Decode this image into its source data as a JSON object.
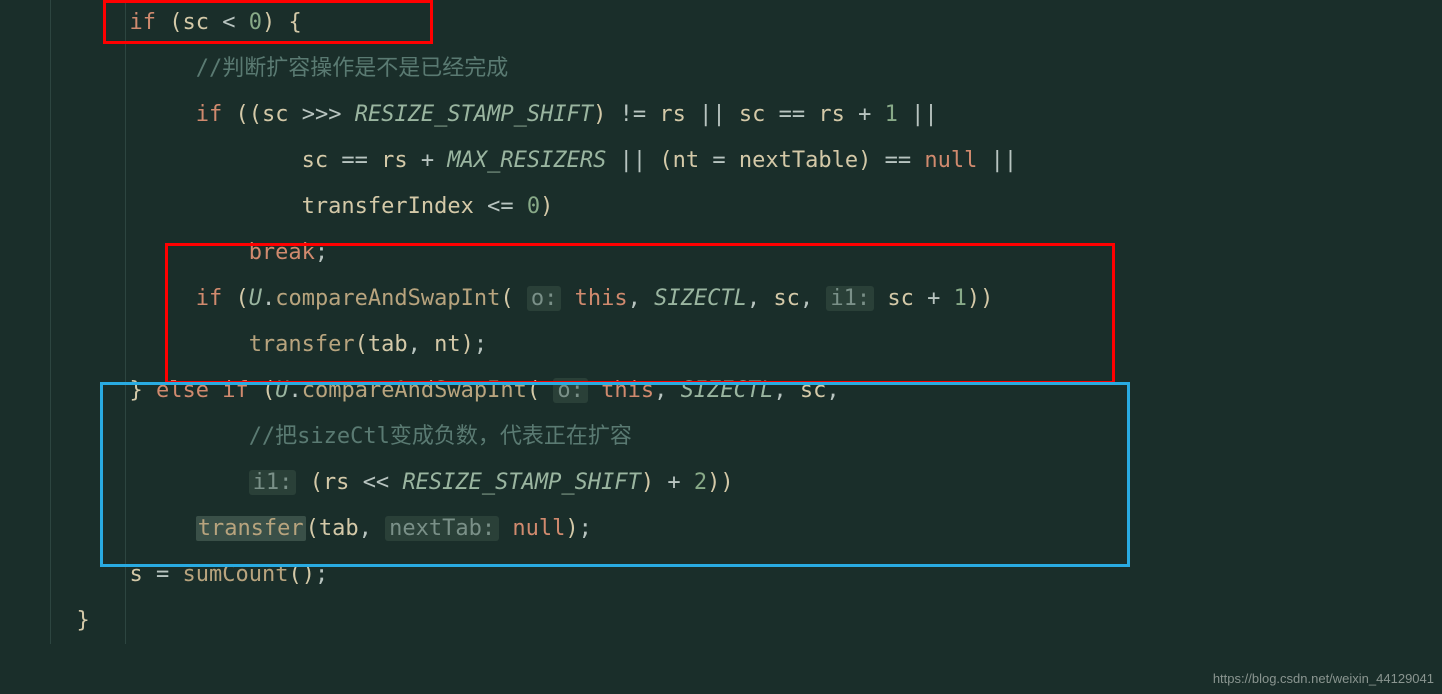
{
  "code": {
    "l1": {
      "if": "if",
      "sc": "sc",
      "lt": "<",
      "zero": "0"
    },
    "l2": {
      "comment": "//判断扩容操作是不是已经完成"
    },
    "l3": {
      "if": "if",
      "sc": "sc",
      "shr": ">>>",
      "rss": "RESIZE_STAMP_SHIFT",
      "ne": "!=",
      "rs": "rs",
      "or": "||",
      "eq": "==",
      "plus": "+",
      "one": "1"
    },
    "l4": {
      "sc": "sc",
      "eq": "==",
      "rs": "rs",
      "plus": "+",
      "mr": "MAX_RESIZERS",
      "or": "||",
      "nt": "nt",
      "nextTable": "nextTable",
      "null": "null"
    },
    "l5": {
      "ti": "transferIndex",
      "le": "<=",
      "zero": "0"
    },
    "l6": {
      "break": "break"
    },
    "l7": {
      "if": "if",
      "U": "U",
      "cas": "compareAndSwapInt",
      "o": "o:",
      "this": "this",
      "sctl": "SIZECTL",
      "sc": "sc",
      "i1": "i1:",
      "plus": "+",
      "one": "1"
    },
    "l8": {
      "transfer": "transfer",
      "tab": "tab",
      "nt": "nt"
    },
    "l9": {
      "else": "else",
      "if": "if",
      "U": "U",
      "cas": "compareAndSwapInt",
      "o": "o:",
      "this": "this",
      "sctl": "SIZECTL",
      "sc": "sc"
    },
    "l10": {
      "comment": "//把sizeCtl变成负数，代表正在扩容"
    },
    "l11": {
      "i1": "i1:",
      "rs": "rs",
      "shl": "<<",
      "rss": "RESIZE_STAMP_SHIFT",
      "plus": "+",
      "two": "2"
    },
    "l12": {
      "transfer": "transfer",
      "tab": "tab",
      "nextTab": "nextTab:",
      "null": "null"
    },
    "l13": {
      "s": "s",
      "sumCount": "sumCount"
    }
  },
  "watermark": "https://blog.csdn.net/weixin_44129041"
}
